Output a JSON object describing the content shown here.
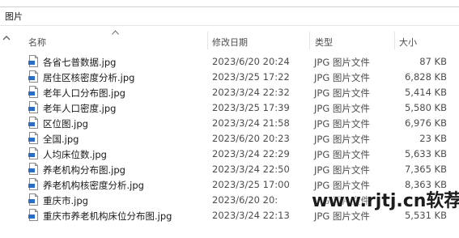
{
  "breadcrumb": "图片",
  "columns": {
    "name": "名称",
    "date": "修改日期",
    "type": "类型",
    "size": "大小"
  },
  "files": [
    {
      "name": "各省七普数据.jpg",
      "date": "2023/6/20 20:24",
      "type": "JPG 图片文件",
      "size": "87 KB"
    },
    {
      "name": "居住区核密度分析.jpg",
      "date": "2023/3/25 17:22",
      "type": "JPG 图片文件",
      "size": "6,828 KB"
    },
    {
      "name": "老年人口分布图.jpg",
      "date": "2023/3/24 22:32",
      "type": "JPG 图片文件",
      "size": "5,414 KB"
    },
    {
      "name": "老年人口密度.jpg",
      "date": "2023/3/25 17:39",
      "type": "JPG 图片文件",
      "size": "5,580 KB"
    },
    {
      "name": "区位图.jpg",
      "date": "2023/3/24 21:58",
      "type": "JPG 图片文件",
      "size": "6,976 KB"
    },
    {
      "name": "全国.jpg",
      "date": "2023/6/20 20:23",
      "type": "JPG 图片文件",
      "size": "23 KB"
    },
    {
      "name": "人均床位数.jpg",
      "date": "2023/3/24 22:29",
      "type": "JPG 图片文件",
      "size": "5,633 KB"
    },
    {
      "name": "养老机构分布图.jpg",
      "date": "2023/3/24 22:50",
      "type": "JPG 图片文件",
      "size": "7,365 KB"
    },
    {
      "name": "养老机构核密度分析.jpg",
      "date": "2023/3/25 17:00",
      "type": "JPG 图片文件",
      "size": "8,363 KB"
    },
    {
      "name": "重庆市.jpg",
      "date": "2023/6/20 20:",
      "type": "JPG 图片文件",
      "size": ""
    },
    {
      "name": "重庆市养老机构床位分布图.jpg",
      "date": "2023/3/24 22:13",
      "type": "JPG 图片文件",
      "size": "5,531 KB"
    }
  ],
  "watermark": "www.rjtj.cn软荐网",
  "colors": {
    "icon_blue": "#2b6cc4",
    "text_secondary": "#4d4d4d"
  },
  "icons": {
    "file": "jpg-file-icon",
    "sort": "sort-ascending-icon",
    "scroll": "scroll-up-icon"
  }
}
